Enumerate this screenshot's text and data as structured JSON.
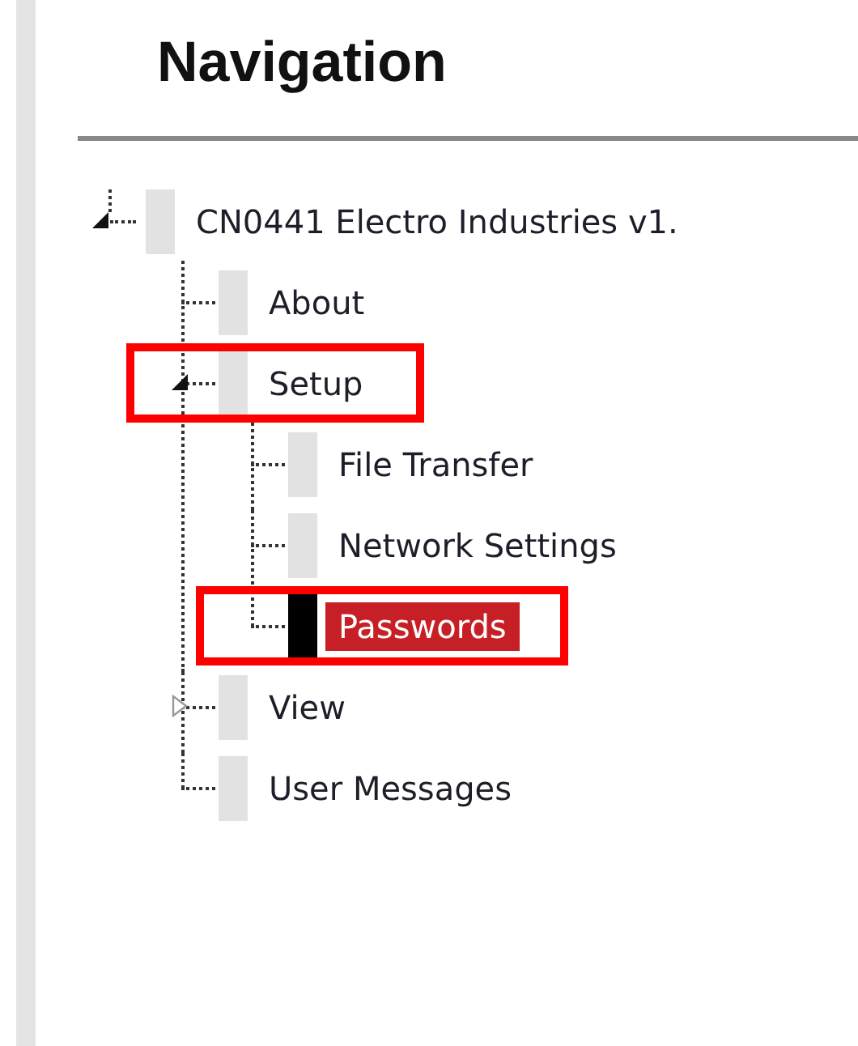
{
  "heading": "Navigation",
  "tree": {
    "label": "CN0441 Electro Industries v1.",
    "expanded": true,
    "selected": false,
    "highlighted": false,
    "children": [
      {
        "label": "About",
        "selected": false,
        "highlighted": false
      },
      {
        "label": "Setup",
        "expanded": true,
        "selected": false,
        "highlighted": true,
        "children": [
          {
            "label": "File Transfer",
            "selected": false,
            "highlighted": false
          },
          {
            "label": "Network Settings",
            "selected": false,
            "highlighted": false
          },
          {
            "label": "Passwords",
            "selected": true,
            "highlighted": true
          }
        ]
      },
      {
        "label": "View",
        "expanded": false,
        "selected": false,
        "highlighted": false
      },
      {
        "label": "User Messages",
        "selected": false,
        "highlighted": false
      }
    ]
  }
}
